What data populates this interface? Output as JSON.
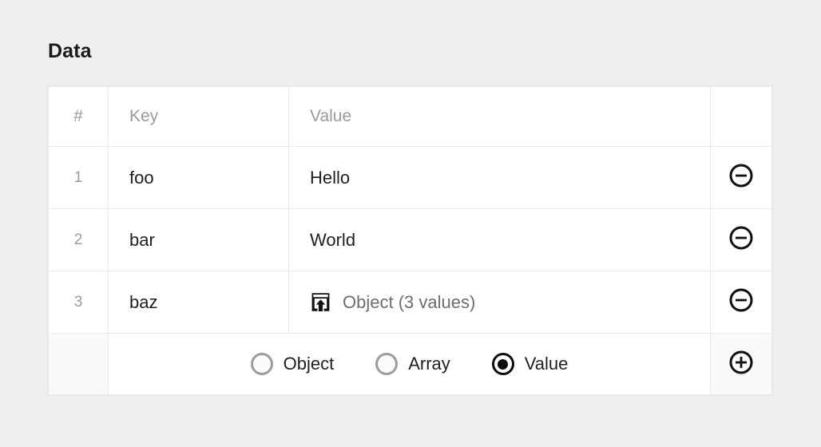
{
  "page": {
    "title": "Data",
    "background_color": "#efefef"
  },
  "table": {
    "columns": [
      {
        "key": "index",
        "label": "#"
      },
      {
        "key": "key",
        "label": "Key"
      },
      {
        "key": "value",
        "label": "Value"
      },
      {
        "key": "action",
        "label": ""
      }
    ],
    "rows": [
      {
        "index": "1",
        "key": "foo",
        "value": "Hello",
        "value_type": "text",
        "remove_label": "remove-row"
      },
      {
        "index": "2",
        "key": "bar",
        "value": "World",
        "value_type": "text",
        "remove_label": "remove-row"
      },
      {
        "index": "3",
        "key": "baz",
        "value": "Object (3 values)",
        "value_type": "object",
        "value_icon": "expand-into-icon",
        "remove_label": "remove-row"
      }
    ],
    "footer": {
      "type_options": [
        {
          "label": "Object",
          "selected": false
        },
        {
          "label": "Array",
          "selected": false
        },
        {
          "label": "Value",
          "selected": true
        }
      ],
      "add_icon": "circle-plus-icon",
      "remove_icon": "circle-minus-icon"
    }
  },
  "colors": {
    "page_background": "#efefef",
    "table_background": "#ffffff",
    "footer_background": "#f9f9f9",
    "border": "#ebebeb",
    "text_primary": "#1f1f1f",
    "text_muted": "#9b9b9b",
    "text_secondary": "#6d6d6d",
    "icon": "#101010",
    "radio_unselected": "#9d9d9d",
    "radio_selected": "#0c0c0c"
  }
}
